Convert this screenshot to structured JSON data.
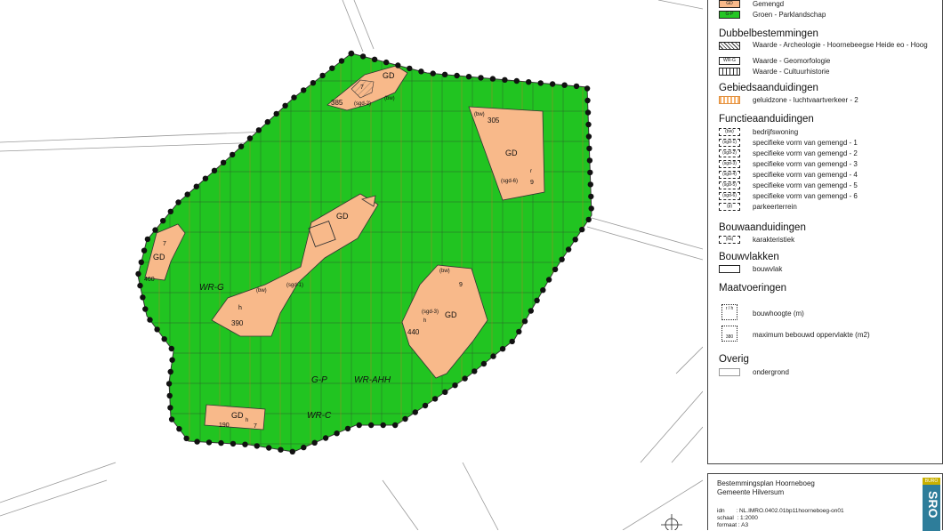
{
  "map": {
    "labels": {
      "wr_g": "WR-G",
      "g_p": "G-P",
      "wr_ahh": "WR-AHH",
      "wr_c": "WR-C"
    },
    "plots": [
      {
        "id": "top",
        "code": "GD",
        "height": "7",
        "area": "385",
        "note": "(sgd-2)",
        "extra": "(bw)"
      },
      {
        "id": "right-top",
        "code": "GD",
        "height": "9",
        "area": "305",
        "note": "(sgd-6)",
        "extra": "(bw)",
        "r": "r"
      },
      {
        "id": "left",
        "code": "GD",
        "height": "7",
        "area": "460"
      },
      {
        "id": "center",
        "code": "GD",
        "height": "h",
        "area": "390",
        "note": "(sgd-1)",
        "extra": "(bw)"
      },
      {
        "id": "right-mid",
        "code": "GD",
        "height": "9",
        "area": "440",
        "note": "(sgd-3)",
        "extra": "(bw)",
        "h": "h"
      },
      {
        "id": "bottom",
        "code": "GD",
        "height": "7",
        "area": "190",
        "h": "h"
      }
    ]
  },
  "legend": {
    "top_items": [
      {
        "swatch": "GD",
        "label": "Gemengd",
        "color": "#f8b98a"
      },
      {
        "swatch": "G-P",
        "label": "Groen - Parklandschap",
        "color": "#23c623"
      }
    ],
    "dubbel": {
      "title": "Dubbelbestemmingen",
      "items": [
        {
          "swatch": "WR-AHH",
          "label": "Waarde - Archeologie - Hoornebeegse Heide eo - Hoog"
        },
        {
          "swatch": "WR-G",
          "label": "Waarde - Geomorfologie"
        },
        {
          "swatch": "WR-C",
          "label": "Waarde - Cultuurhistorie"
        }
      ]
    },
    "gebied": {
      "title": "Gebiedsaanduidingen",
      "items": [
        {
          "swatch": "",
          "label": "geluidzone - luchtvaartverkeer - 2",
          "color": "#f7b16a"
        }
      ]
    },
    "functie": {
      "title": "Functieaanduidingen",
      "items": [
        {
          "swatch": "(bw)",
          "label": "bedrijfswoning"
        },
        {
          "swatch": "(sgd-1)",
          "label": "specifieke vorm van gemengd - 1"
        },
        {
          "swatch": "(sgd-2)",
          "label": "specifieke vorm van gemengd - 2"
        },
        {
          "swatch": "(sgd-3)",
          "label": "specifieke vorm van gemengd - 3"
        },
        {
          "swatch": "(sgd-4)",
          "label": "specifieke vorm van gemengd - 4"
        },
        {
          "swatch": "(sgd-5)",
          "label": "specifieke vorm van gemengd - 5"
        },
        {
          "swatch": "(sgd-6)",
          "label": "specifieke vorm van gemengd - 6"
        },
        {
          "swatch": "(p)",
          "label": "parkeerterrein"
        }
      ]
    },
    "bouwaand": {
      "title": "Bouwaanduidingen",
      "items": [
        {
          "swatch": "(ka)",
          "label": "karakteristiek"
        }
      ]
    },
    "bouwvlak": {
      "title": "Bouwvlakken",
      "items": [
        {
          "swatch": "",
          "label": "bouwvlak"
        }
      ]
    },
    "maat": {
      "title": "Maatvoeringen",
      "items": [
        {
          "swatch": "r / h",
          "label": "bouwhoogte (m)"
        },
        {
          "swatch": "380",
          "label": "maximum bebouwd oppervlakte (m2)"
        }
      ]
    },
    "overig": {
      "title": "Overig",
      "items": [
        {
          "swatch": "",
          "label": "ondergrond"
        }
      ]
    }
  },
  "titleblock": {
    "title": "Bestemmingsplan Hoorneboeg",
    "municipality": "Gemeente Hilversum",
    "idn_label": "idn",
    "idn_value": ": NL.IMRO.0402.01bp11hoorneboeg-on01",
    "schaal_label": "schaal",
    "schaal_value": ": 1:2000",
    "formaat_label": "formaat",
    "formaat_value": ": A3",
    "logo_top": "BURO",
    "logo": "SRO"
  }
}
